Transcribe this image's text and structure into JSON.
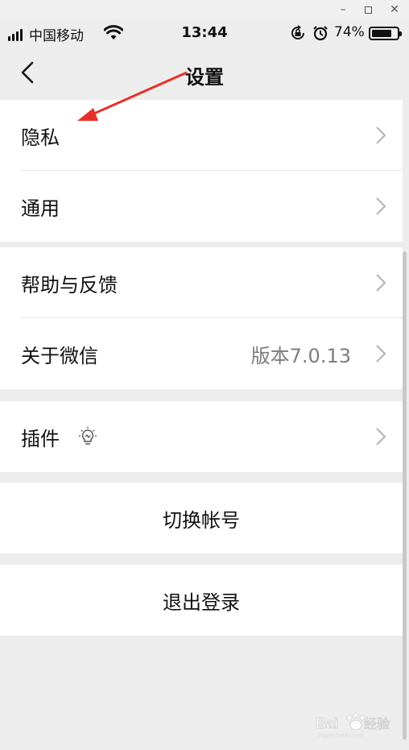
{
  "window": {
    "minimize": "–",
    "maximize": "",
    "close": "✕"
  },
  "status_bar": {
    "carrier": "中国移动",
    "time": "13:44",
    "battery_percent": "74%",
    "icons": [
      "signal-icon",
      "wifi-icon",
      "rotation-lock-icon",
      "alarm-icon",
      "battery-icon"
    ]
  },
  "nav": {
    "title": "设置",
    "back_icon": "chevron-left-icon"
  },
  "groups": [
    {
      "rows": [
        {
          "label": "隐私"
        },
        {
          "label": "通用"
        }
      ]
    },
    {
      "rows": [
        {
          "label": "帮助与反馈"
        },
        {
          "label": "关于微信",
          "value": "版本7.0.13"
        }
      ]
    },
    {
      "rows": [
        {
          "label": "插件",
          "icon": "lightbulb-icon"
        }
      ]
    },
    {
      "rows": [
        {
          "label": "切换帐号"
        }
      ]
    },
    {
      "rows": [
        {
          "label": "退出登录"
        }
      ]
    }
  ],
  "colors": {
    "background": "#ededed",
    "row_background": "#ffffff",
    "text": "#111111",
    "secondary_text": "#7d7d7d",
    "chevron": "#b2b2b2",
    "annotation_arrow": "#e8302a"
  }
}
